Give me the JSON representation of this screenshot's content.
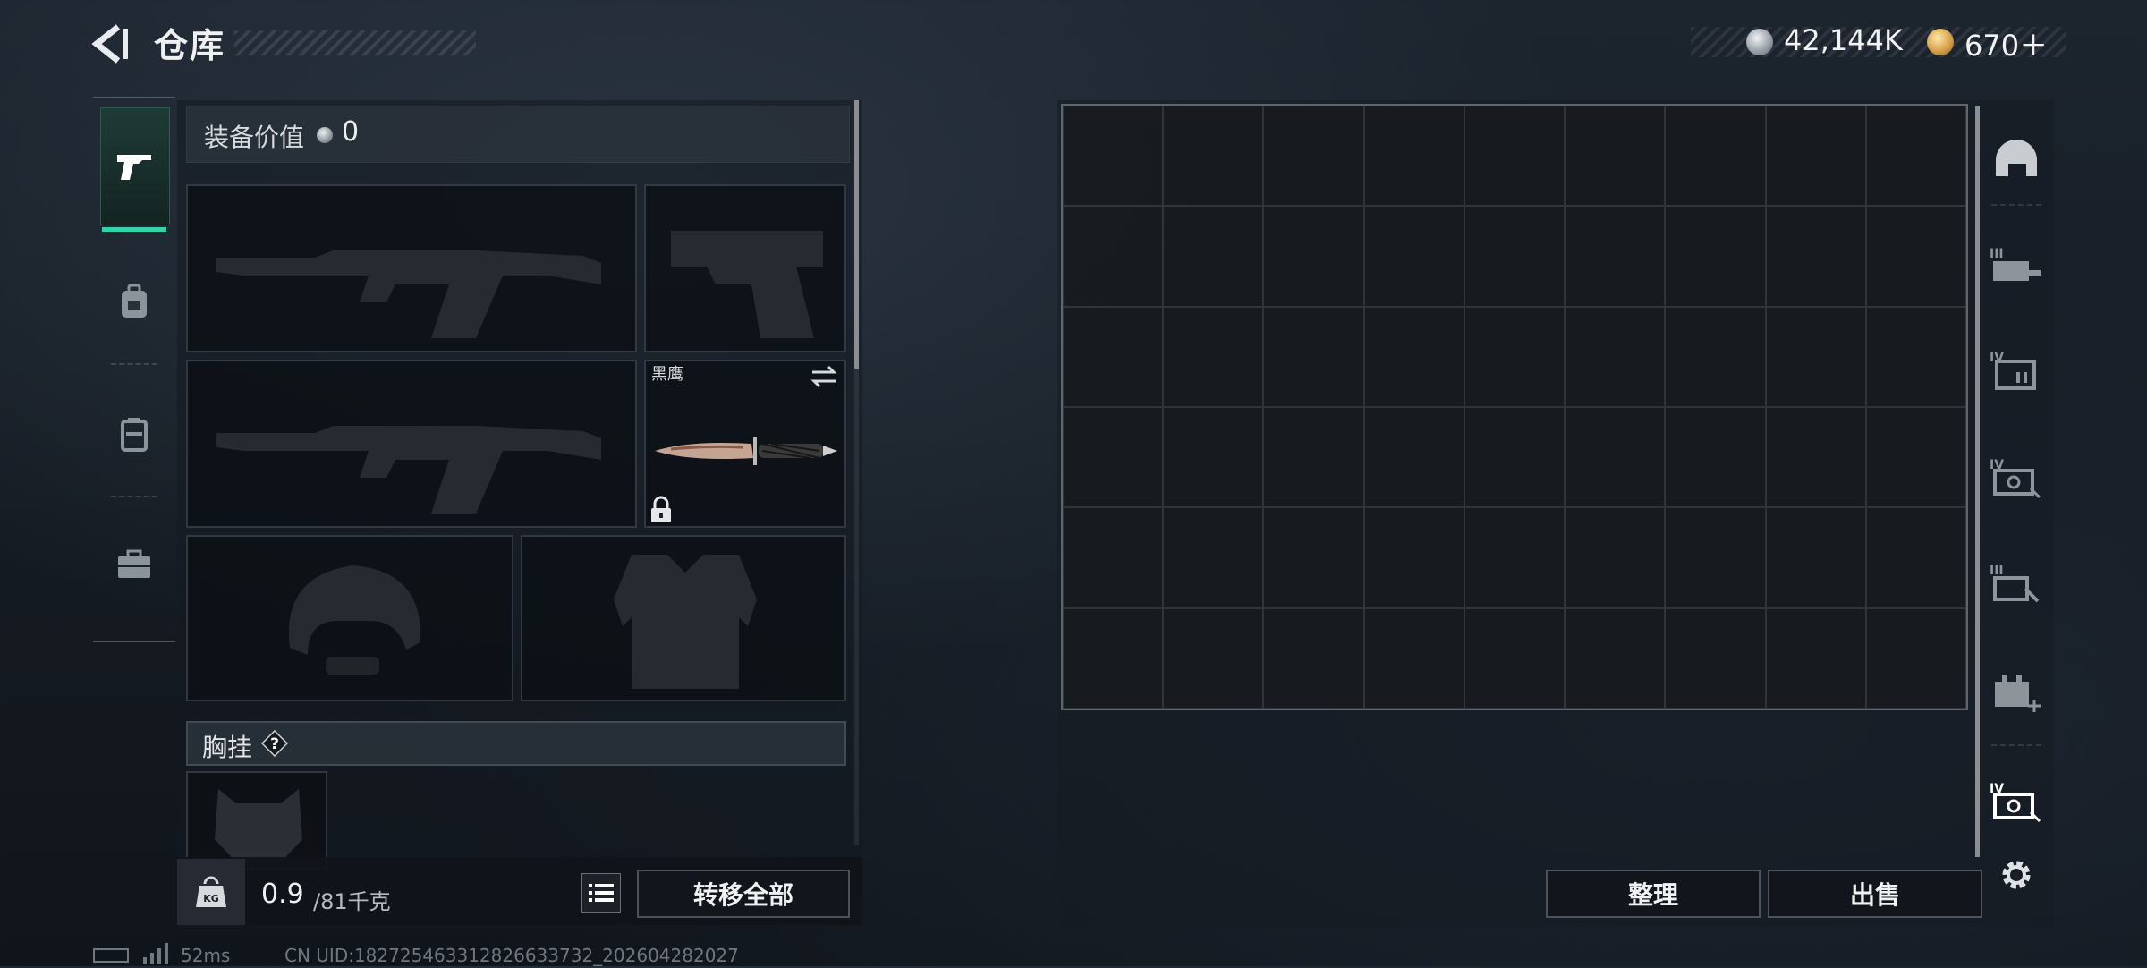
{
  "header": {
    "title": "仓库",
    "silver_amount": "42,144K",
    "gold_amount": "670＋"
  },
  "equipment": {
    "value_label": "装备价值",
    "value_amount": "0",
    "melee_name": "黑鹰",
    "chest_label": "胸挂",
    "chest_help": "?",
    "weight_current": "0.9",
    "weight_max": "/81千克",
    "weight_icon_text": "KG",
    "transfer_all": "转移全部"
  },
  "storage": {
    "rows": 6,
    "cols": 9,
    "sort_label": "整理",
    "sell_label": "出售",
    "side_icons": [
      "helmet-icon",
      "armor-slot-III-icon",
      "backpack-IV-icon",
      "chest-rig-IV-icon",
      "chest-rig-III-icon",
      "medkit-icon",
      "rig-IV-icon",
      "settings-icon"
    ]
  },
  "tabs": [
    "pistol-icon",
    "backpack-icon",
    "case-icon",
    "toolbox-icon"
  ],
  "status": {
    "ping": "52ms",
    "uid": "CN UID:18272546331282663​3732_202604282027"
  },
  "colors": {
    "accent": "#37d3a5",
    "silver": "#9aa1a8",
    "gold": "#d5a24a"
  }
}
